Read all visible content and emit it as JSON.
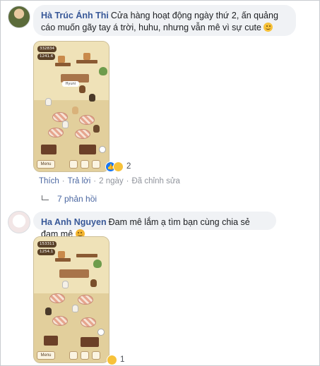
{
  "comments": [
    {
      "author": "Hà Trúc Ánh Thi",
      "text": "Cửa hàng hoạt động ngày thứ 2, ấn quảng cáo muốn gãy tay á trời, huhu, nhưng vẫn mê vì sự cute",
      "emoji_icon": "pleading-face-emoji",
      "screenshot": {
        "stat_1": "332834",
        "stat_2": "1241.6",
        "sign_label": "Hyuni",
        "menu_label": "Menu"
      },
      "reactions": {
        "icons": [
          "like-icon",
          "haha-icon"
        ],
        "count": "2"
      },
      "actions": {
        "like": "Thích",
        "reply": "Trả lời",
        "time": "2 ngày",
        "edited": "Đã chỉnh sửa"
      },
      "replies_label": "7 phản hồi"
    },
    {
      "author": "Ha Anh Nguyen",
      "text": "Đam mê lắm ạ tìm bạn cùng chia sẻ đam mê",
      "emoji_icon": "smiling-face-with-hearts-emoji",
      "screenshot": {
        "stat_1": "153311",
        "stat_2": "1254.1",
        "menu_label": "Menu"
      },
      "reactions": {
        "icons": [
          "haha-icon"
        ],
        "count": "1"
      }
    }
  ],
  "colors": {
    "name": "#385898",
    "bubble": "#f0f2f5",
    "link": "#4b67a1",
    "meta": "#90949c",
    "like": "#1877f2",
    "haha": "#f7c23a"
  }
}
